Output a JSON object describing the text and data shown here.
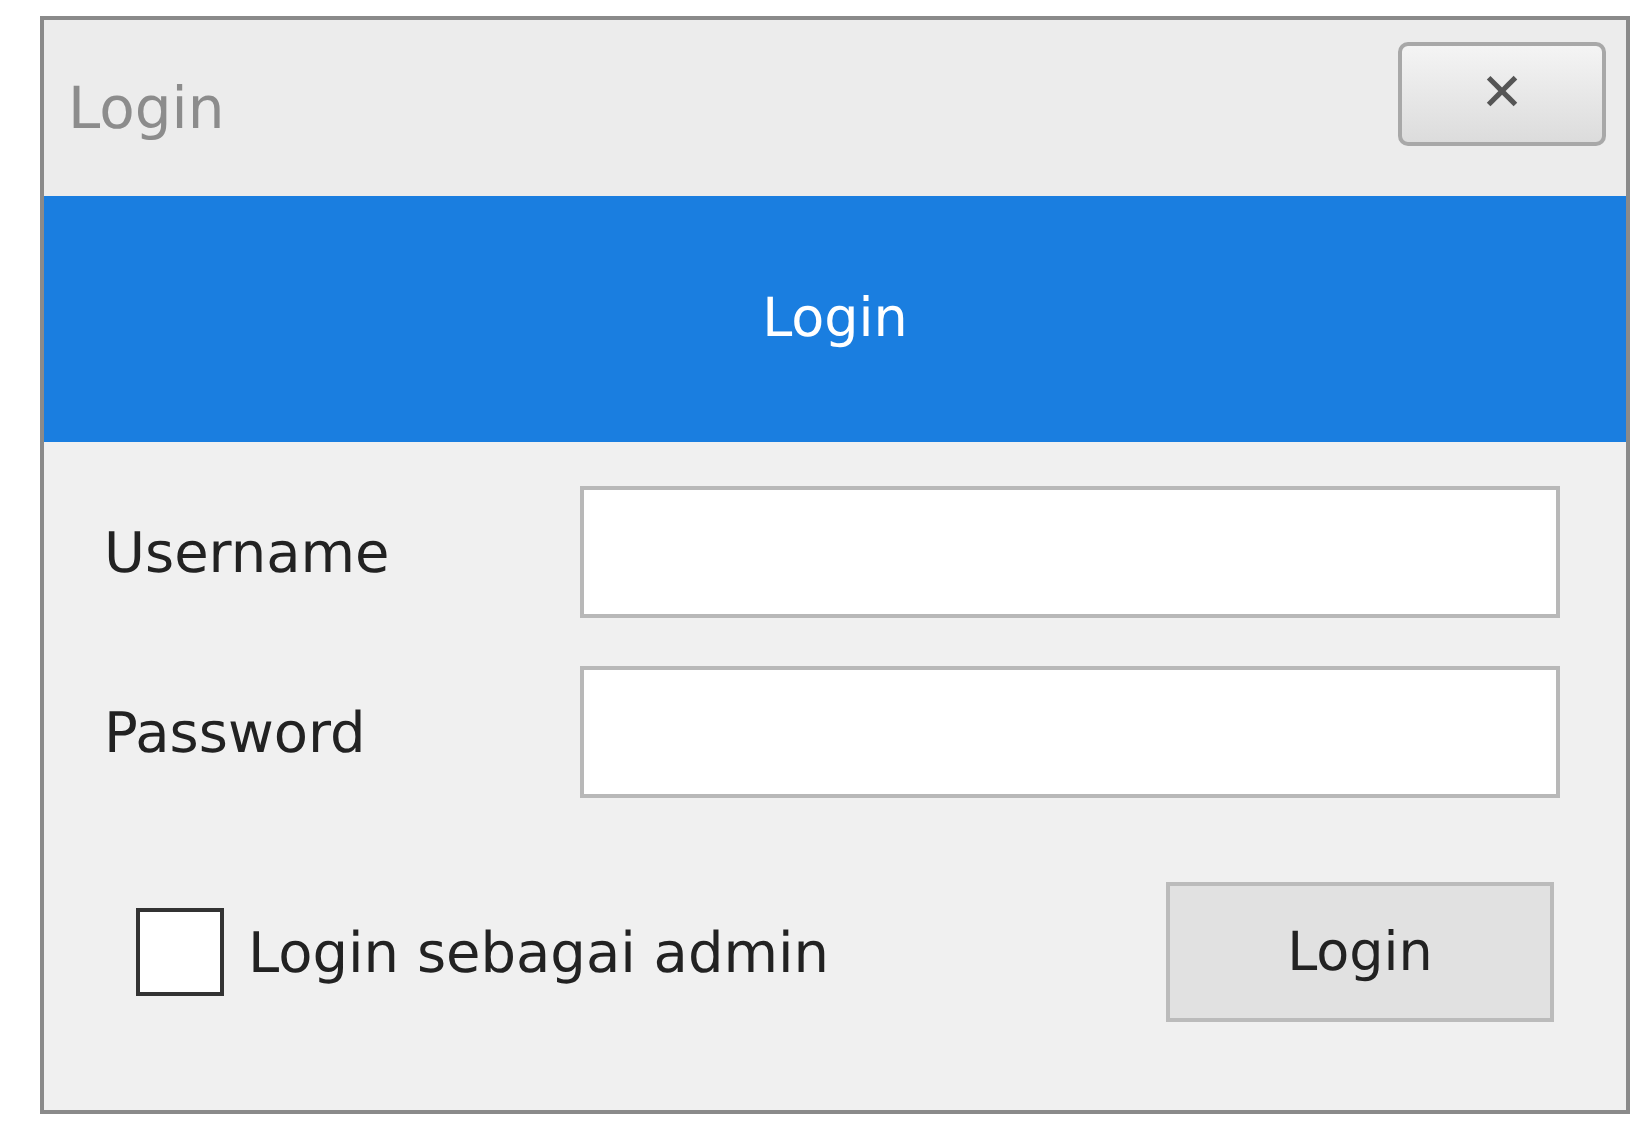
{
  "window": {
    "title": "Login",
    "close": "✕"
  },
  "header": {
    "title": "Login"
  },
  "fields": [
    {
      "label": "Username"
    },
    {
      "label": "Password"
    }
  ],
  "admin_checkbox": {
    "label": "Login sebagai admin",
    "checked": false
  },
  "submit_button": "Login"
}
